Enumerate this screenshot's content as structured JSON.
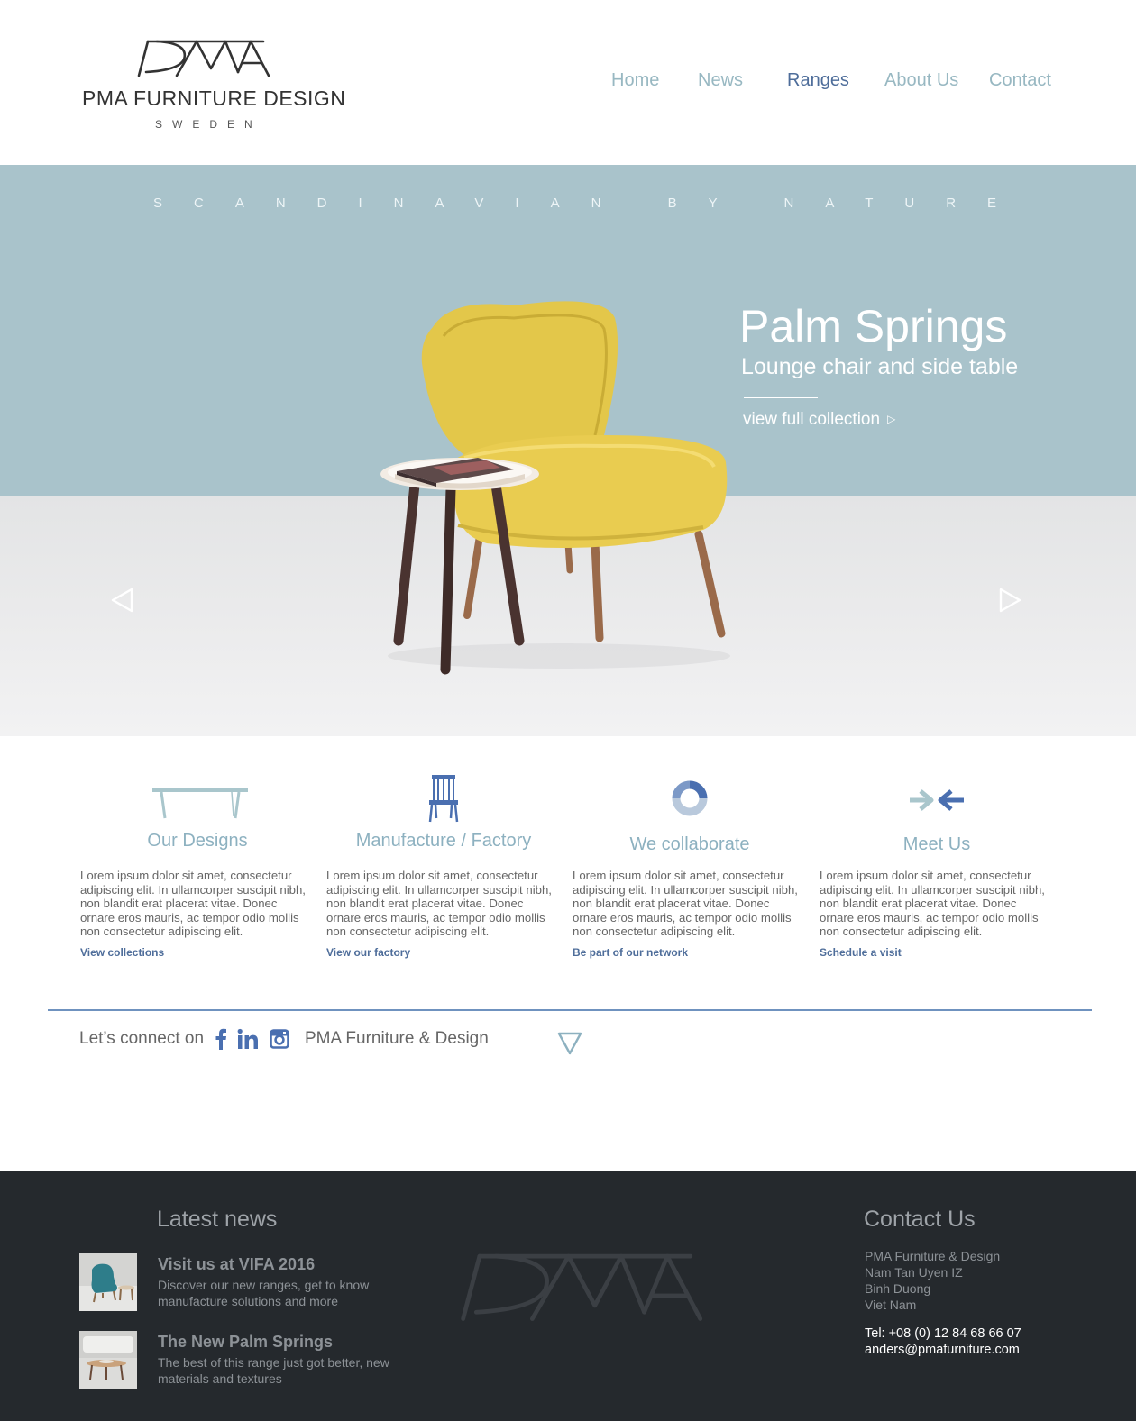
{
  "header": {
    "logo": {
      "mark_text": "PMA",
      "name": "PMA FURNITURE DESIGN",
      "sub": "SWEDEN"
    },
    "nav": [
      {
        "label": "Home",
        "active": false
      },
      {
        "label": "News",
        "active": false
      },
      {
        "label": "Ranges",
        "active": true
      },
      {
        "label": "About Us",
        "active": false
      },
      {
        "label": "Contact",
        "active": false
      }
    ]
  },
  "hero": {
    "tagline": "SCANDINAVIAN  BY  NATURE",
    "title": "Palm Springs",
    "subtitle": "Lounge chair and side table",
    "link_label": "view full collection",
    "link_icon": "triangle-right-icon",
    "prev_icon": "arrow-left-icon",
    "next_icon": "arrow-right-icon"
  },
  "features": [
    {
      "icon": "table-icon",
      "title": "Our Designs",
      "text": "Lorem ipsum dolor sit amet, consectetur adipiscing elit. In ullamcorper suscipit nibh, non blandit erat placerat vitae. Donec ornare eros mauris, ac tempor odio mollis non consectetur adipiscing elit.",
      "link": "View collections"
    },
    {
      "icon": "chair-icon",
      "title": "Manufacture / Factory",
      "text": "Lorem ipsum dolor sit amet, consectetur adipiscing elit. In ullamcorper suscipit nibh, non blandit erat placerat vitae. Donec ornare eros mauris, ac tempor odio mollis non consectetur adipiscing elit.",
      "link": "View our factory"
    },
    {
      "icon": "ring-icon",
      "title": "We collaborate",
      "text": "Lorem ipsum dolor sit amet, consectetur adipiscing elit. In ullamcorper suscipit nibh, non blandit erat placerat vitae. Donec ornare eros mauris, ac tempor odio mollis non consectetur adipiscing elit.",
      "link": "Be part of our network"
    },
    {
      "icon": "meet-arrows-icon",
      "title": "Meet Us",
      "text": "Lorem ipsum dolor sit amet, consectetur adipiscing elit. In ullamcorper suscipit nibh, non blandit erat placerat vitae. Donec ornare eros mauris, ac tempor odio mollis non consectetur adipiscing elit.",
      "link": "Schedule a visit"
    }
  ],
  "connect": {
    "label": "Let’s connect on",
    "name": "PMA Furniture & Design",
    "icons": [
      "facebook-icon",
      "linkedin-icon",
      "instagram-icon"
    ]
  },
  "footer": {
    "latest_title": "Latest news",
    "news": [
      {
        "title": "Visit us at VIFA 2016",
        "desc": "Discover our new ranges, get to know manufacture solutions and more"
      },
      {
        "title": "The New Palm Springs",
        "desc": "The best of this range just got better, new materials and textures"
      }
    ],
    "contact_title": "Contact Us",
    "contact_lines": [
      "PMA Furniture & Design",
      "Nam Tan Uyen IZ",
      "Binh Duong",
      "Viet Nam"
    ],
    "tel": "Tel: +08 (0) 12 84 68 66 07",
    "email": "anders@pmafurniture.com"
  },
  "colors": {
    "nav": "#98b8c2",
    "nav_active": "#4e6d9a",
    "hero_wall": "#a9c3cb",
    "link": "#4e6d9a",
    "footer_bg": "#25292d"
  }
}
